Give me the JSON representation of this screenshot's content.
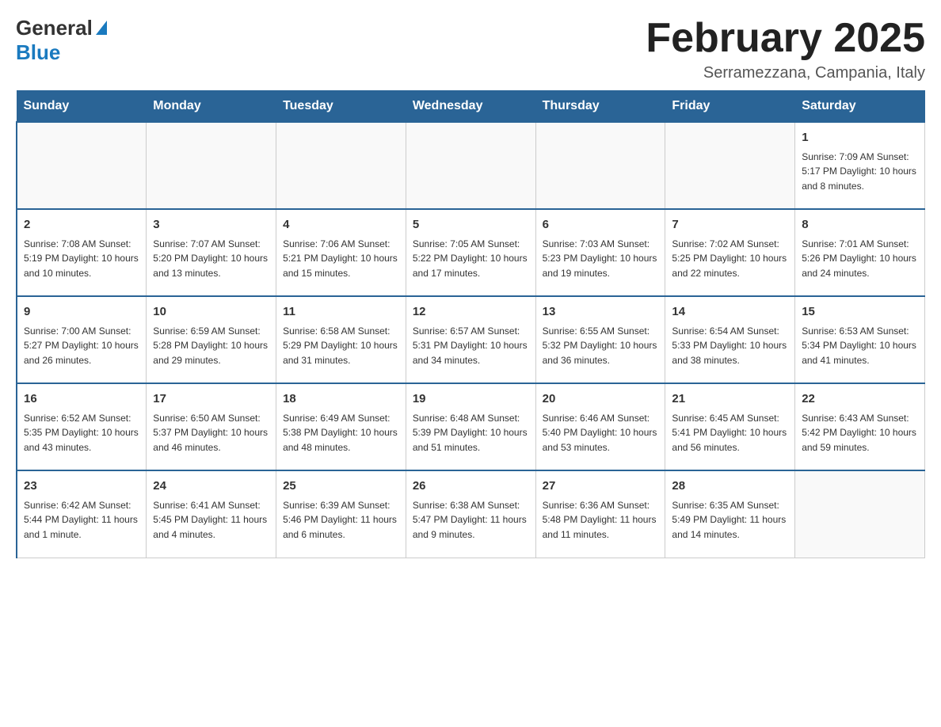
{
  "logo": {
    "general": "General",
    "blue": "Blue"
  },
  "title": "February 2025",
  "subtitle": "Serramezzana, Campania, Italy",
  "days_of_week": [
    "Sunday",
    "Monday",
    "Tuesday",
    "Wednesday",
    "Thursday",
    "Friday",
    "Saturday"
  ],
  "weeks": [
    [
      {
        "day": "",
        "info": ""
      },
      {
        "day": "",
        "info": ""
      },
      {
        "day": "",
        "info": ""
      },
      {
        "day": "",
        "info": ""
      },
      {
        "day": "",
        "info": ""
      },
      {
        "day": "",
        "info": ""
      },
      {
        "day": "1",
        "info": "Sunrise: 7:09 AM\nSunset: 5:17 PM\nDaylight: 10 hours and 8 minutes."
      }
    ],
    [
      {
        "day": "2",
        "info": "Sunrise: 7:08 AM\nSunset: 5:19 PM\nDaylight: 10 hours and 10 minutes."
      },
      {
        "day": "3",
        "info": "Sunrise: 7:07 AM\nSunset: 5:20 PM\nDaylight: 10 hours and 13 minutes."
      },
      {
        "day": "4",
        "info": "Sunrise: 7:06 AM\nSunset: 5:21 PM\nDaylight: 10 hours and 15 minutes."
      },
      {
        "day": "5",
        "info": "Sunrise: 7:05 AM\nSunset: 5:22 PM\nDaylight: 10 hours and 17 minutes."
      },
      {
        "day": "6",
        "info": "Sunrise: 7:03 AM\nSunset: 5:23 PM\nDaylight: 10 hours and 19 minutes."
      },
      {
        "day": "7",
        "info": "Sunrise: 7:02 AM\nSunset: 5:25 PM\nDaylight: 10 hours and 22 minutes."
      },
      {
        "day": "8",
        "info": "Sunrise: 7:01 AM\nSunset: 5:26 PM\nDaylight: 10 hours and 24 minutes."
      }
    ],
    [
      {
        "day": "9",
        "info": "Sunrise: 7:00 AM\nSunset: 5:27 PM\nDaylight: 10 hours and 26 minutes."
      },
      {
        "day": "10",
        "info": "Sunrise: 6:59 AM\nSunset: 5:28 PM\nDaylight: 10 hours and 29 minutes."
      },
      {
        "day": "11",
        "info": "Sunrise: 6:58 AM\nSunset: 5:29 PM\nDaylight: 10 hours and 31 minutes."
      },
      {
        "day": "12",
        "info": "Sunrise: 6:57 AM\nSunset: 5:31 PM\nDaylight: 10 hours and 34 minutes."
      },
      {
        "day": "13",
        "info": "Sunrise: 6:55 AM\nSunset: 5:32 PM\nDaylight: 10 hours and 36 minutes."
      },
      {
        "day": "14",
        "info": "Sunrise: 6:54 AM\nSunset: 5:33 PM\nDaylight: 10 hours and 38 minutes."
      },
      {
        "day": "15",
        "info": "Sunrise: 6:53 AM\nSunset: 5:34 PM\nDaylight: 10 hours and 41 minutes."
      }
    ],
    [
      {
        "day": "16",
        "info": "Sunrise: 6:52 AM\nSunset: 5:35 PM\nDaylight: 10 hours and 43 minutes."
      },
      {
        "day": "17",
        "info": "Sunrise: 6:50 AM\nSunset: 5:37 PM\nDaylight: 10 hours and 46 minutes."
      },
      {
        "day": "18",
        "info": "Sunrise: 6:49 AM\nSunset: 5:38 PM\nDaylight: 10 hours and 48 minutes."
      },
      {
        "day": "19",
        "info": "Sunrise: 6:48 AM\nSunset: 5:39 PM\nDaylight: 10 hours and 51 minutes."
      },
      {
        "day": "20",
        "info": "Sunrise: 6:46 AM\nSunset: 5:40 PM\nDaylight: 10 hours and 53 minutes."
      },
      {
        "day": "21",
        "info": "Sunrise: 6:45 AM\nSunset: 5:41 PM\nDaylight: 10 hours and 56 minutes."
      },
      {
        "day": "22",
        "info": "Sunrise: 6:43 AM\nSunset: 5:42 PM\nDaylight: 10 hours and 59 minutes."
      }
    ],
    [
      {
        "day": "23",
        "info": "Sunrise: 6:42 AM\nSunset: 5:44 PM\nDaylight: 11 hours and 1 minute."
      },
      {
        "day": "24",
        "info": "Sunrise: 6:41 AM\nSunset: 5:45 PM\nDaylight: 11 hours and 4 minutes."
      },
      {
        "day": "25",
        "info": "Sunrise: 6:39 AM\nSunset: 5:46 PM\nDaylight: 11 hours and 6 minutes."
      },
      {
        "day": "26",
        "info": "Sunrise: 6:38 AM\nSunset: 5:47 PM\nDaylight: 11 hours and 9 minutes."
      },
      {
        "day": "27",
        "info": "Sunrise: 6:36 AM\nSunset: 5:48 PM\nDaylight: 11 hours and 11 minutes."
      },
      {
        "day": "28",
        "info": "Sunrise: 6:35 AM\nSunset: 5:49 PM\nDaylight: 11 hours and 14 minutes."
      },
      {
        "day": "",
        "info": ""
      }
    ]
  ]
}
